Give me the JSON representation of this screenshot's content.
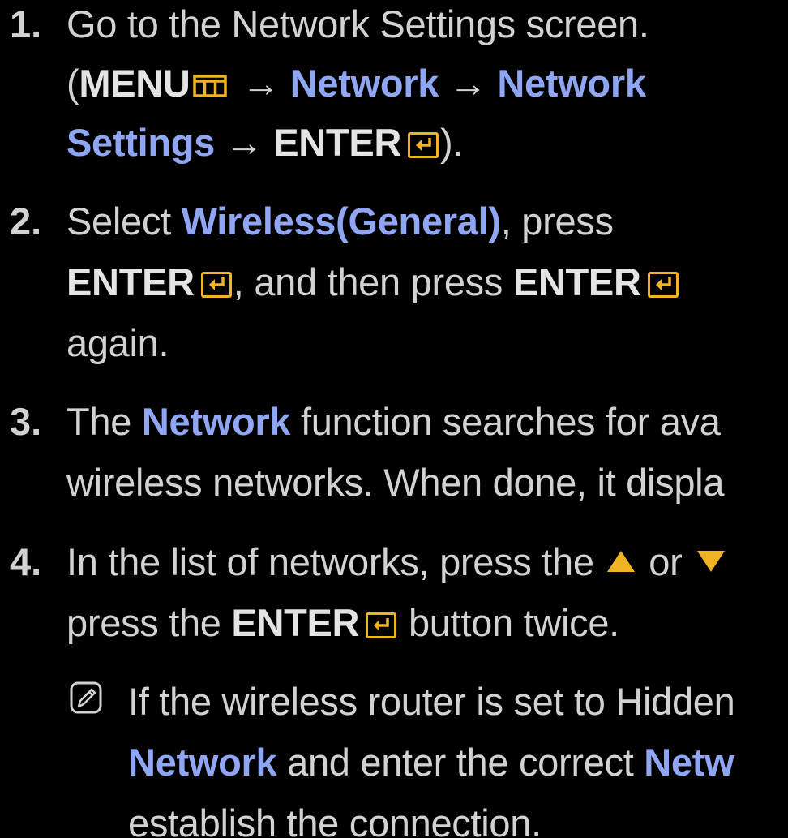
{
  "steps": [
    {
      "number": "1.",
      "lines": [
        {
          "t1": "Go to the Network Settings screen."
        },
        {
          "open": "(",
          "menu": "MENU",
          "arrow1": " → ",
          "network1": "Network",
          "arrow2": " → ",
          "network2": "Network"
        },
        {
          "settings": "Settings",
          "arrow3": " → ",
          "enter": "ENTER",
          "close": ")."
        }
      ]
    },
    {
      "number": "2.",
      "lines": [
        {
          "select": "Select ",
          "wireless": "Wireless(General)",
          "press": ", press"
        },
        {
          "enter1": "ENTER",
          "and_then": ", and then press ",
          "enter2": "ENTER"
        },
        {
          "again": "again."
        }
      ]
    },
    {
      "number": "3.",
      "lines": [
        {
          "the": "The ",
          "network": "Network",
          "rest": " function searches for ava"
        },
        {
          "text": "wireless networks. When done, it displa"
        }
      ]
    },
    {
      "number": "4.",
      "lines": [
        {
          "text": "In the list of networks, press the ",
          "or": " or "
        },
        {
          "press_the": "press the ",
          "enter": "ENTER",
          "button_twice": " button twice."
        }
      ]
    }
  ],
  "note": {
    "line1": "If the wireless router is set to Hidden",
    "network1": "Network",
    "line2_mid": " and enter the correct ",
    "network2": "Netw",
    "line3": "establish the connection."
  },
  "colors": {
    "background": "#000000",
    "text": "#d2d2d2",
    "highlight_blue": "#8fa6f5",
    "icon_yellow": "#f0b323"
  },
  "icons": [
    "menu-icon",
    "enter-icon",
    "up-triangle-icon",
    "down-triangle-icon",
    "note-icon"
  ]
}
